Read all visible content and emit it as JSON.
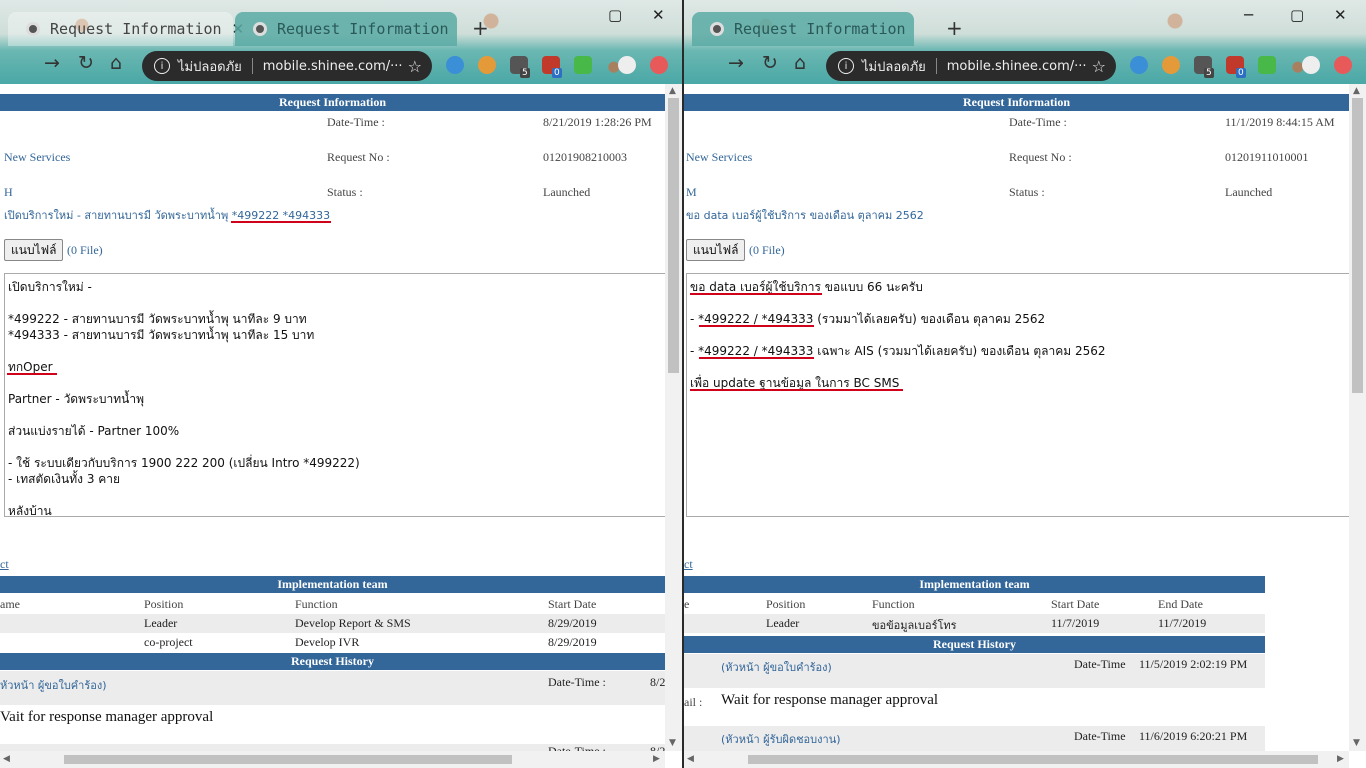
{
  "browser": {
    "tab_title": "Request Information",
    "insecure_label": "ไม่ปลอดภัย",
    "url": "mobile.shinee.com/···",
    "new_tab": "+",
    "close_glyph": "✕",
    "ext_badges": [
      "5",
      "0"
    ]
  },
  "common": {
    "header_request_info": "Request Information",
    "label_datetime": "Date-Time :",
    "label_request_no": "Request No :",
    "label_status": "Status :",
    "category": "New Services",
    "attach_button": "แนบไฟล์",
    "file_count": "(0 File)",
    "link_fragment": "ct",
    "header_impl_team": "Implementation team",
    "header_history": "Request History",
    "col_position": "Position",
    "col_function": "Function",
    "col_start": "Start Date",
    "col_end": "End Date",
    "history_datetime_label": "Date-Time :",
    "history_detail": "Wait for response manager approval"
  },
  "left": {
    "datetime": "8/21/2019 1:28:26 PM",
    "request_no": "01201908210003",
    "priority": "H",
    "status": "Launched",
    "subject": "เปิดบริการใหม่ - สายทานบารมี วัดพระบาทน้ำพุ *499222 *494333",
    "body_lines": [
      "เปิดบริการใหม่ -",
      "*499222 - สายทานบารมี วัดพระบาทน้ำพุ นาทีละ 9 บาท",
      "*494333 - สายทานบารมี วัดพระบาทน้ำพุ นาทีละ 15 บาท",
      "ทกOper",
      "Partner - วัดพระบาทน้ำพุ",
      "ส่วนแบ่งรายได้ - Partner 100%",
      "- ใช้ ระบบเดียวกับบริการ 1900 222 200 (เปลี่ยน Intro *499222)",
      "- เทสตัดเงินทั้ง 3 คาย",
      "หลังบ้าน"
    ],
    "col_name": "ame",
    "team": [
      {
        "position": "Leader",
        "function": "Develop Report & SMS",
        "start": "8/29/2019"
      },
      {
        "position": "co-project",
        "function": "Develop IVR",
        "start": "8/29/2019"
      }
    ],
    "history_who": "หัวหน้า ผู้ขอใบคำร้อง)",
    "history_dt_trunc": "8/2",
    "history_detail": "Vait for response manager approval",
    "history_next_dt": "8/2"
  },
  "right": {
    "datetime": "11/1/2019 8:44:15 AM",
    "request_no": "01201911010001",
    "priority": "M",
    "status": "Launched",
    "subject": "ขอ data เบอร์ผู้ใช้บริการ ของเดือน ตุลาคม 2562",
    "body_lines": [
      "ขอ data เบอร์ผู้ใช้บริการ ขอแบบ 66 นะครับ",
      "- *499222 / *494333 (รวมมาได้เลยครับ) ของเดือน ตุลาคม  2562",
      "- *499222 / *494333 เฉพาะ AIS (รวมมาได้เลยครับ) ของเดือน ตุลาคม  2562",
      "เพื่อ update ฐานข้อมูล ในการ BC SMS"
    ],
    "col_name": "e",
    "team": [
      {
        "position": "Leader",
        "function": "ขอข้อมูลเบอร์โทร",
        "start": "11/7/2019",
        "end": "11/7/2019"
      }
    ],
    "history1_who": "(หัวหน้า ผู้ขอใบคำร้อง)",
    "history1_dt_label": "Date-Time",
    "history1_dt": "11/5/2019 2:02:19 PM",
    "history1_detail_label": "ail :",
    "history1_detail": "Wait for response manager approval",
    "history2_who": "(หัวหน้า ผู้รับผิดชอบงาน)",
    "history2_dt": "11/6/2019 6:20:21 PM"
  },
  "colors": {
    "header_bar": "#336699",
    "underline": "#d0021b",
    "link": "#336699"
  }
}
